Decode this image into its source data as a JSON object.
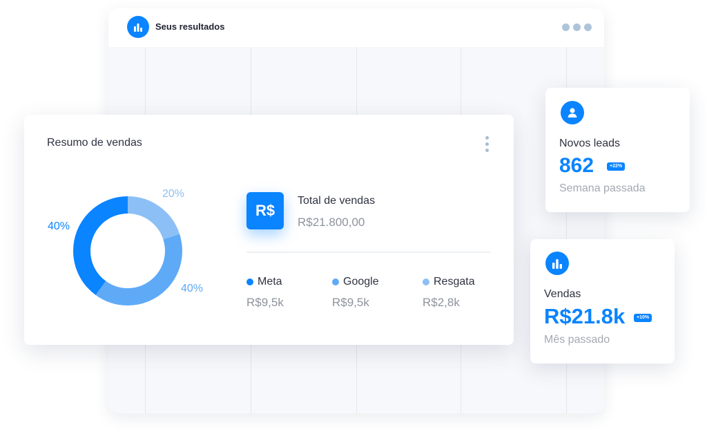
{
  "header": {
    "title": "Seus resultados",
    "logo_icon": "bar-chart-icon"
  },
  "sales_summary": {
    "title": "Resumo de vendas",
    "donut_labels": [
      "20%",
      "40%",
      "40%"
    ],
    "total_label": "Total de vendas",
    "total_value": "R$21.800,00",
    "currency_badge": "R$",
    "legend": [
      {
        "label": "Meta",
        "value": "R$9,5k",
        "color": "#0a84ff"
      },
      {
        "label": "Google",
        "value": "R$9,5k",
        "color": "#5eaaf7"
      },
      {
        "label": "Resgata",
        "value": "R$2,8k",
        "color": "#8cbff5"
      }
    ]
  },
  "chart_data": {
    "type": "pie",
    "categories": [
      "Meta",
      "Google",
      "Resgata"
    ],
    "values": [
      40,
      40,
      20
    ],
    "colors": [
      "#0a84ff",
      "#5eaaf7",
      "#8cbff5"
    ]
  },
  "leads_card": {
    "label": "Novos leads",
    "value": "862",
    "badge": "+22%",
    "sub": "Semana passada",
    "icon": "user-icon"
  },
  "sales_card": {
    "label": "Vendas",
    "value": "R$21.8k",
    "badge": "+10%",
    "sub": "Mês passado",
    "icon": "bar-chart-icon"
  },
  "colors": {
    "accent": "#0a84ff"
  }
}
